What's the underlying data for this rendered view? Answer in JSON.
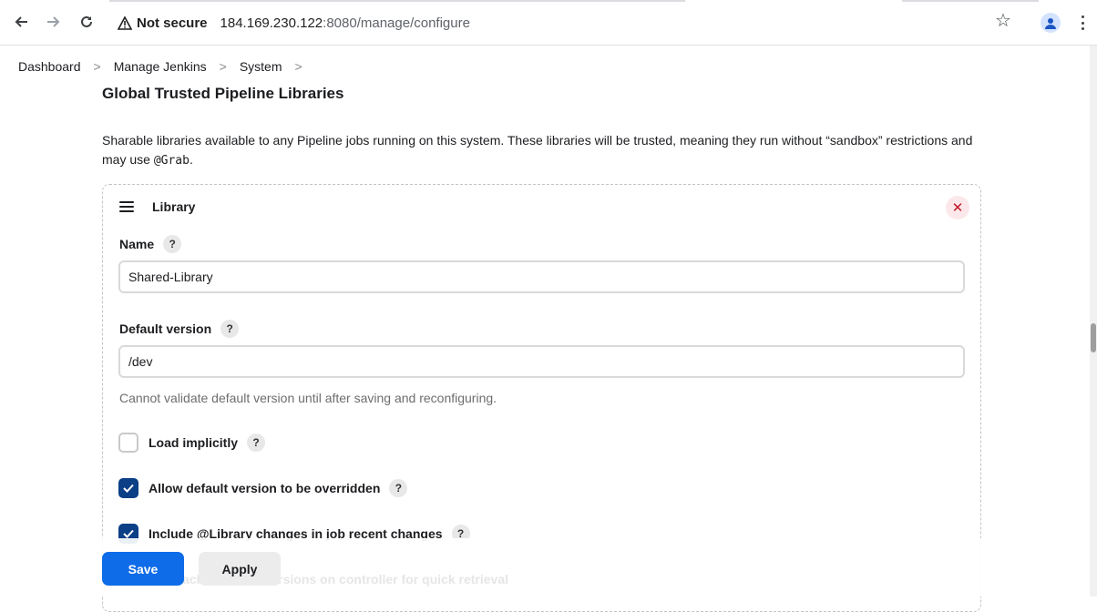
{
  "browser": {
    "security_label": "Not secure",
    "url_host": "184.169.230.122",
    "url_rest": ":8080/manage/configure"
  },
  "breadcrumb": [
    "Dashboard",
    "Manage Jenkins",
    "System"
  ],
  "section": {
    "title": "Global Trusted Pipeline Libraries",
    "description_before": "Sharable libraries available to any Pipeline jobs running on this system. These libraries will be trusted, meaning they run without “sandbox” restrictions and may use ",
    "description_code": "@Grab",
    "description_after": "."
  },
  "library": {
    "title": "Library",
    "name_label": "Name",
    "name_value": "Shared-Library",
    "default_version_label": "Default version",
    "default_version_value": "/dev",
    "default_version_hint": "Cannot validate default version until after saving and reconfiguring.",
    "load_implicitly_label": "Load implicitly",
    "load_implicitly_checked": false,
    "allow_override_label": "Allow default version to be overridden",
    "allow_override_checked": true,
    "include_changes_label": "Include @Library changes in job recent changes",
    "include_changes_checked": true,
    "cache_label": "Cache fetched versions on controller for quick retrieval"
  },
  "actions": {
    "save": "Save",
    "apply": "Apply"
  },
  "colors": {
    "primary": "#0e6ce8",
    "checkbox_checked": "#0b3f86",
    "danger": "#c0152b"
  }
}
